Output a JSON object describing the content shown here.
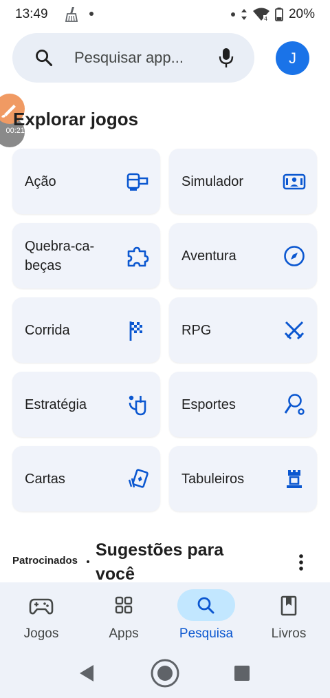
{
  "status_bar": {
    "time": "13:49",
    "battery": "20%"
  },
  "search": {
    "placeholder": "Pesquisar app..."
  },
  "account": {
    "initial": "J"
  },
  "recorder": {
    "time": "00:21"
  },
  "section": {
    "title": "Explorar jogos"
  },
  "categories": [
    {
      "label": "Ação",
      "icon": "action-icon"
    },
    {
      "label": "Simulador",
      "icon": "simulator-icon"
    },
    {
      "label": "Quebra-ca-beças",
      "icon": "puzzle-icon"
    },
    {
      "label": "Aventura",
      "icon": "compass-icon"
    },
    {
      "label": "Corrida",
      "icon": "checkered-flag-icon"
    },
    {
      "label": "RPG",
      "icon": "crossed-swords-icon"
    },
    {
      "label": "Estratégia",
      "icon": "strategy-icon"
    },
    {
      "label": "Esportes",
      "icon": "racket-icon"
    },
    {
      "label": "Cartas",
      "icon": "cards-icon"
    },
    {
      "label": "Tabuleiros",
      "icon": "chess-rook-icon"
    }
  ],
  "suggestions": {
    "sponsored_label": "Patrocinados",
    "title": "Sugestões para você"
  },
  "bottom_nav": [
    {
      "label": "Jogos",
      "icon": "gamepad-icon",
      "active": false
    },
    {
      "label": "Apps",
      "icon": "apps-grid-icon",
      "active": false
    },
    {
      "label": "Pesquisa",
      "icon": "search-icon",
      "active": true
    },
    {
      "label": "Livros",
      "icon": "book-icon",
      "active": false
    }
  ],
  "colors": {
    "accent": "#0b57d0",
    "card_bg": "#f0f3fa",
    "search_bg": "#e9eef6",
    "active_pill": "#c2e7ff",
    "avatar": "#1a73e8"
  }
}
